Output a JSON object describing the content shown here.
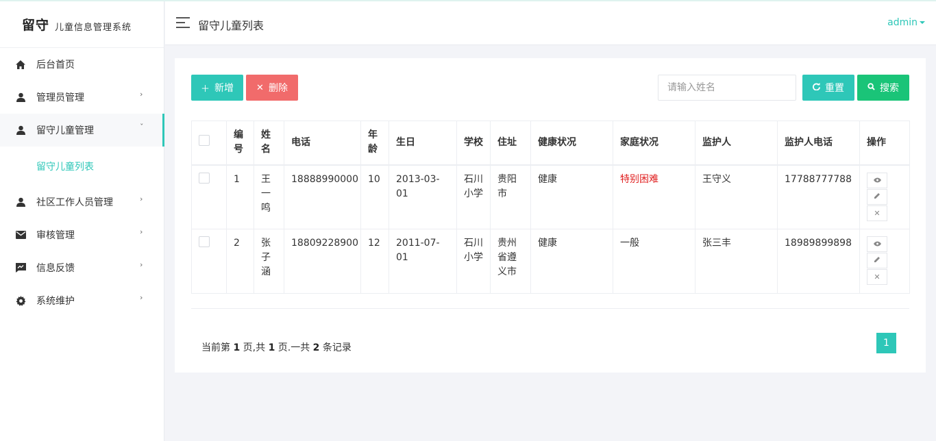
{
  "brand": {
    "main": "留守",
    "sub": "儿童信息管理系统"
  },
  "sidebar": {
    "items": [
      {
        "label": "后台首页",
        "icon": "home-icon"
      },
      {
        "label": "管理员管理",
        "icon": "user-icon"
      },
      {
        "label": "留守儿童管理",
        "icon": "user-icon"
      },
      {
        "label": "社区工作人员管理",
        "icon": "user-icon"
      },
      {
        "label": "审核管理",
        "icon": "mail-icon"
      },
      {
        "label": "信息反馈",
        "icon": "feedback-icon"
      },
      {
        "label": "系统维护",
        "icon": "gear-icon"
      }
    ],
    "submenu": {
      "label": "留守儿童列表"
    }
  },
  "header": {
    "title": "留守儿童列表",
    "user": "admin"
  },
  "toolbar": {
    "add_label": "新增",
    "delete_label": "删除",
    "search_placeholder": "请输入姓名",
    "reset_label": "重置",
    "search_label": "搜索"
  },
  "table": {
    "headers": [
      "编号",
      "姓名",
      "电话",
      "年龄",
      "生日",
      "学校",
      "住址",
      "健康状况",
      "家庭状况",
      "监护人",
      "监护人电话",
      "操作"
    ],
    "rows": [
      {
        "id": "1",
        "name": "王一鸣",
        "phone": "18888990000",
        "age": "10",
        "birthday": "2013-03-01",
        "school": "石川小学",
        "address": "贵阳市",
        "health": "健康",
        "family": "特别困难",
        "guardian": "王守义",
        "guardian_phone": "17788777788"
      },
      {
        "id": "2",
        "name": "张子涵",
        "phone": "18809228900",
        "age": "12",
        "birthday": "2011-07-01",
        "school": "石川小学",
        "address": "贵州省遵义市",
        "health": "健康",
        "family": "一般",
        "guardian": "张三丰",
        "guardian_phone": "18989899898"
      }
    ]
  },
  "pager": {
    "prefix": "当前第",
    "current": "1",
    "mid1": "页,共",
    "total_pages": "1",
    "mid2": "页.一共",
    "total_records": "2",
    "suffix": "条记录",
    "page_button": "1"
  },
  "colors": {
    "accent": "#2ec7b8",
    "danger": "#f16b6b",
    "search_green": "#1ac478",
    "alert_text": "#e02020"
  }
}
